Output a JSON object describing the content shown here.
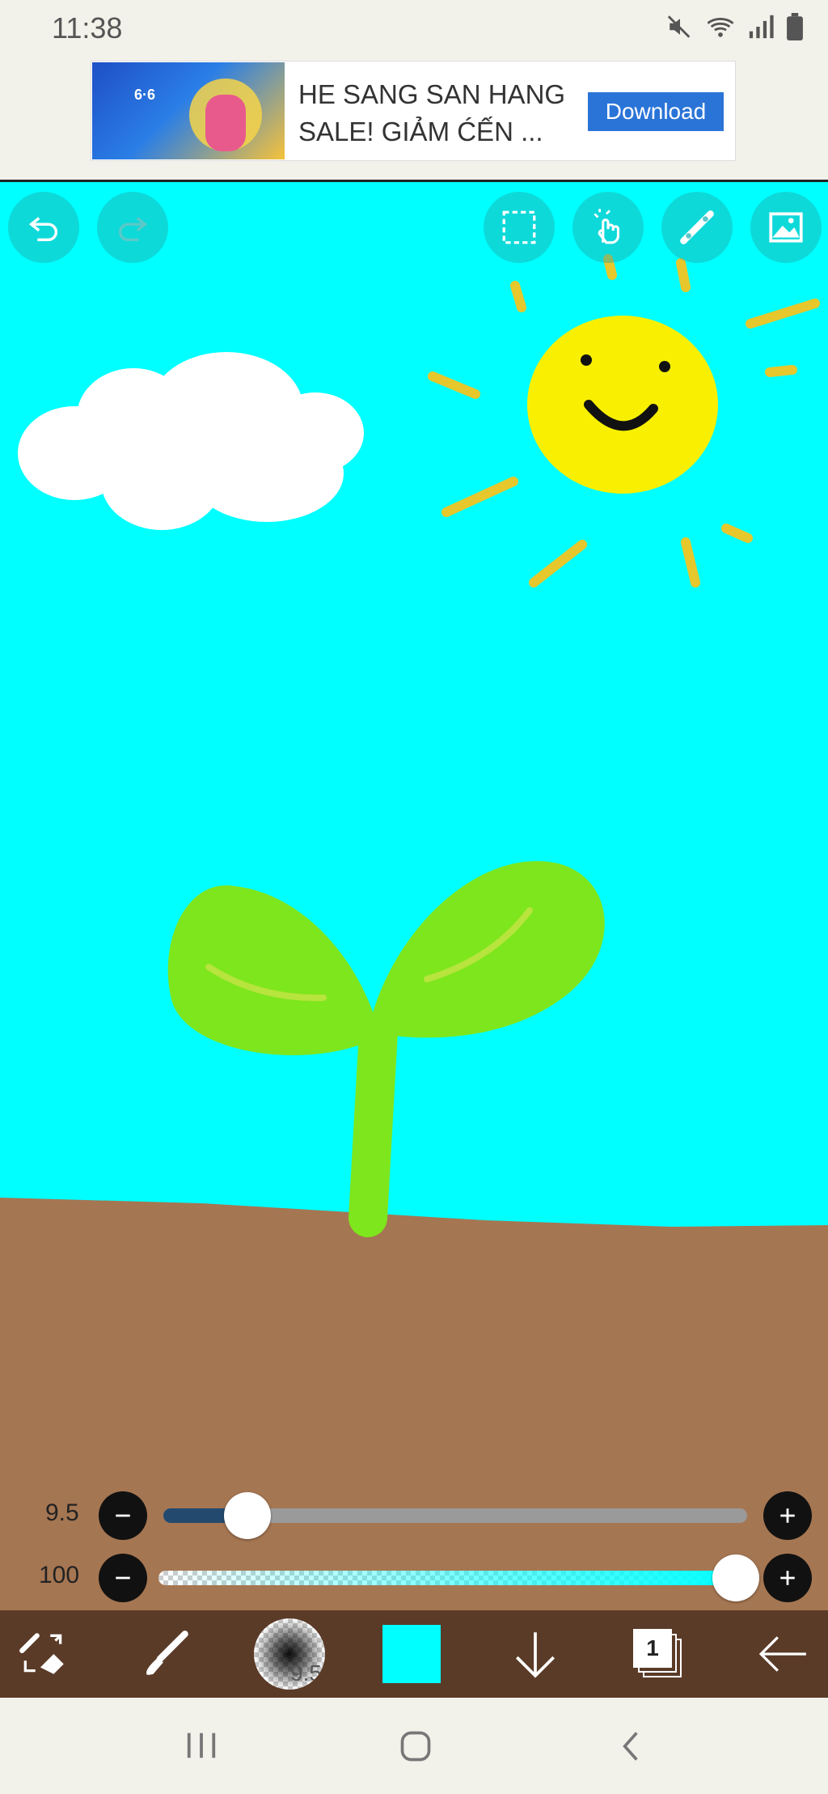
{
  "status": {
    "time": "11:38",
    "icons": [
      "mute-icon",
      "wifi-icon",
      "signal-icon",
      "battery-icon"
    ]
  },
  "ad": {
    "image_label": "6·6",
    "headline": "HE SANG SAN HANG SALE! GIẢM ĆẾN ...",
    "line1": "HE SANG SAN HANG",
    "line2": "SALE! GIẢM ĆẾN ...",
    "cta": "Download"
  },
  "canvas": {
    "background_color": "#00ffff",
    "top_tools": [
      "undo-icon",
      "redo-icon",
      "selection-icon",
      "hand-icon",
      "ruler-icon",
      "image-icon"
    ]
  },
  "brush_size": {
    "value": "9.5",
    "fraction": 0.14
  },
  "opacity": {
    "value": "100",
    "fraction": 1.0
  },
  "toolbar": {
    "brush_preview_label": "9.5",
    "current_color": "#00ffff",
    "layer_count": "1",
    "icons": [
      "swap-tool-icon",
      "brush-icon",
      "brush-size-preview",
      "color-swatch",
      "download-icon",
      "layers-icon",
      "back-arrow-icon"
    ]
  },
  "nav": {
    "icons": [
      "recents-icon",
      "home-icon",
      "back-icon"
    ]
  }
}
